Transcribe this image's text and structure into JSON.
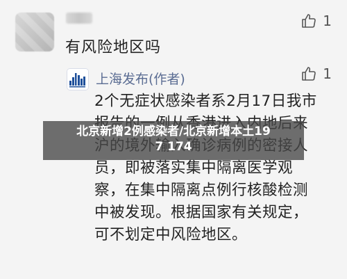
{
  "comment": {
    "text": "有风险地区吗",
    "like_count": "1"
  },
  "reply": {
    "author": "上海发布(作者)",
    "like_count": "1",
    "body": "2个无症状感染者系2月17日我市报告的一例从香港进入内地后来沪的境外输入确诊病例的密接人员，即被落实集中隔离医学观察，在集中隔离点例行核酸检测中被发现。根据国家有关规定，可不划定中风险地区。"
  },
  "banner": {
    "line1": "北京新增2例感染者/北京新增本土19",
    "line2": "7 174"
  },
  "icons": {
    "like": "thumbs-up-icon",
    "reply_avatar": "shanghai-skyline-logo"
  },
  "colors": {
    "author_name": "#5b6d93",
    "banner_bg": "#464646"
  }
}
